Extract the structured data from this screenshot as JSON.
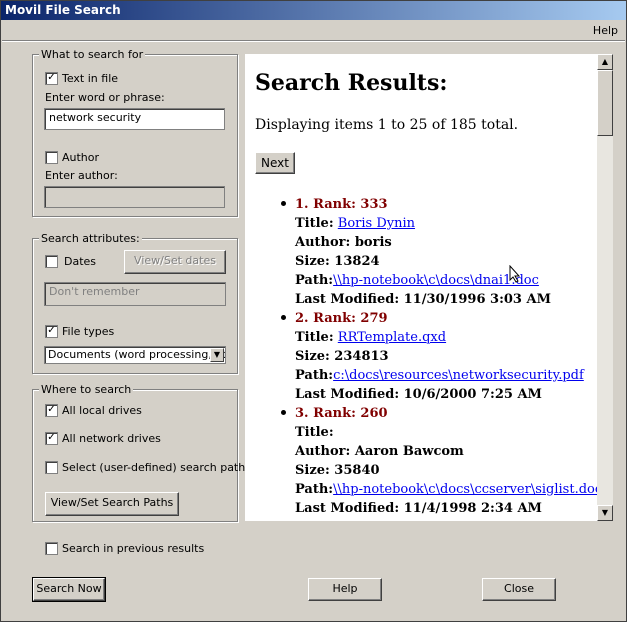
{
  "window": {
    "title": "Movil File Search"
  },
  "menu": {
    "help": "Help"
  },
  "what_group": {
    "legend": "What to search for",
    "text_in_file": {
      "label": "Text in file",
      "checked": true
    },
    "phrase_label": "Enter word or phrase:",
    "phrase_value": "network security",
    "author": {
      "label": "Author",
      "checked": false
    },
    "author_label": "Enter author:",
    "author_value": ""
  },
  "attr_group": {
    "legend": "Search attributes:",
    "dates": {
      "label": "Dates",
      "checked": false
    },
    "view_set_dates": "View/Set dates",
    "date_value": "Don't remember",
    "file_types": {
      "label": "File types",
      "checked": true
    },
    "file_type_selected": "Documents (word processing, etc"
  },
  "where_group": {
    "legend": "Where to search",
    "local": {
      "label": "All local drives",
      "checked": true
    },
    "network": {
      "label": "All network drives",
      "checked": true
    },
    "user_path": {
      "label": "Select (user-defined) search path",
      "checked": false
    },
    "view_paths": "View/Set Search Paths"
  },
  "previous": {
    "label": "Search in previous results",
    "checked": false
  },
  "buttons": {
    "search_now": "Search Now",
    "help": "Help",
    "close": "Close"
  },
  "results": {
    "heading": "Search Results:",
    "displaying": "Displaying items 1 to 25 of 185 total.",
    "next": "Next",
    "items": [
      {
        "rank": "1. Rank: 333",
        "title_label": "Title:",
        "title": "Boris Dynin",
        "author": "Author: boris",
        "size": "Size: 13824",
        "path_label": "Path:",
        "path": "\\\\hp-notebook\\c\\docs\\dnai1.doc",
        "modified": "Last Modified: 11/30/1996 3:03 AM"
      },
      {
        "rank": "2. Rank: 279",
        "title_label": "Title:",
        "title": "RRTemplate.qxd",
        "size": "Size: 234813",
        "path_label": "Path:",
        "path": "c:\\docs\\resources\\networksecurity.pdf",
        "modified": "Last Modified: 10/6/2000 7:25 AM"
      },
      {
        "rank": "3. Rank: 260",
        "title_label": "Title:",
        "title": "",
        "author": "Author: Aaron Bawcom",
        "size": "Size: 35840",
        "path_label": "Path:",
        "path": "\\\\hp-notebook\\c\\docs\\ccserver\\siglist.doc",
        "modified": "Last Modified: 11/4/1998 2:34 AM"
      }
    ]
  },
  "icons": {
    "check": "✓",
    "up": "▲",
    "down": "▼",
    "cursor": "arrow-cursor"
  }
}
